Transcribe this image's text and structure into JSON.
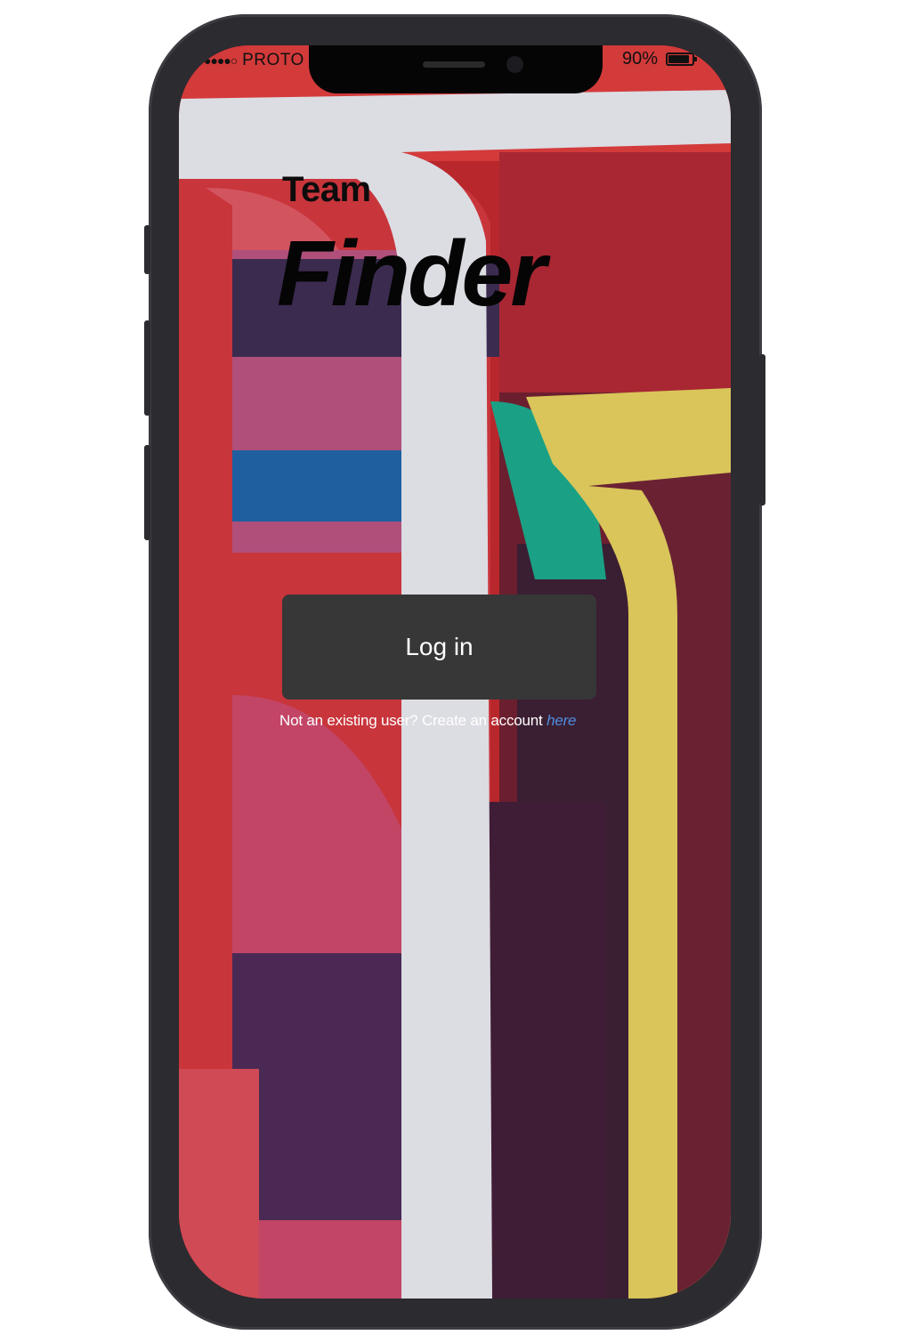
{
  "status_bar": {
    "signal_dots": "●●●●○",
    "carrier": "PROTO",
    "battery_percent": "90%",
    "battery_level": 0.9
  },
  "app": {
    "title_line1": "Team",
    "title_line2": "Finder"
  },
  "login": {
    "button_label": "Log in",
    "signup_prompt": "Not an existing user? Create an account ",
    "signup_link": "here"
  },
  "colors": {
    "button_bg": "#373737",
    "link": "#4f8fe0",
    "frame": "#2c2b30"
  }
}
